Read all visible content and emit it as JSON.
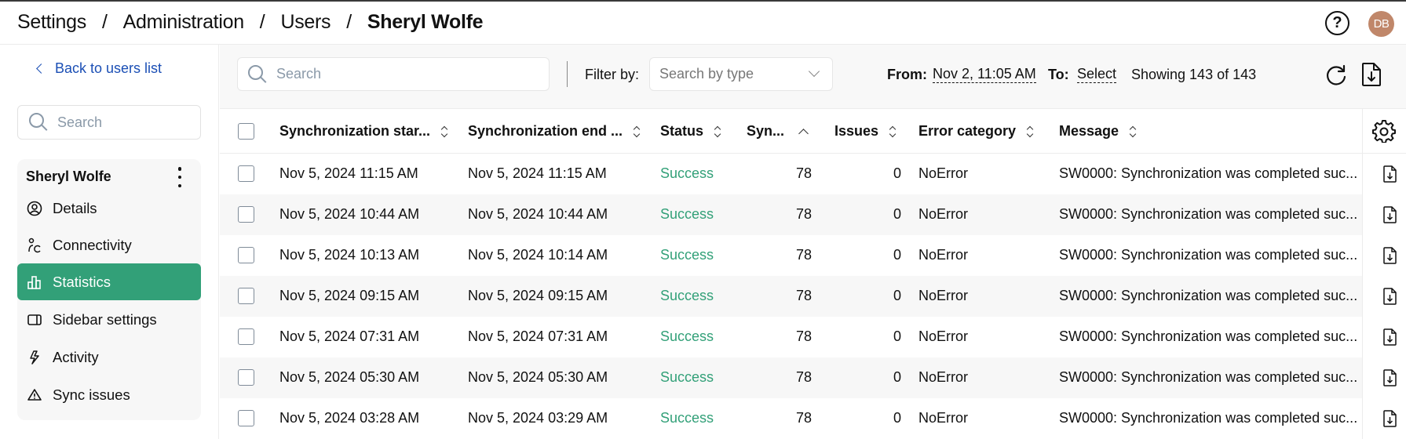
{
  "header": {
    "breadcrumb": [
      "Settings",
      "Administration",
      "Users",
      "Sheryl Wolfe"
    ],
    "separator": "/",
    "help_icon": "?",
    "avatar_initials": "DB"
  },
  "sidebar": {
    "back_label": "Back to users list",
    "search_placeholder": "Search",
    "user_name": "Sheryl Wolfe",
    "items": [
      {
        "label": "Details",
        "icon": "user-circle-icon"
      },
      {
        "label": "Connectivity",
        "icon": "connectivity-icon"
      },
      {
        "label": "Statistics",
        "icon": "bar-chart-icon",
        "active": true
      },
      {
        "label": "Sidebar settings",
        "icon": "sidebar-panel-icon"
      },
      {
        "label": "Activity",
        "icon": "lightning-icon"
      },
      {
        "label": "Sync issues",
        "icon": "warning-triangle-icon"
      }
    ]
  },
  "toolbar": {
    "search_placeholder": "Search",
    "filter_label": "Filter by:",
    "filter_placeholder": "Search by type",
    "from_label": "From:",
    "from_value": "Nov 2, 11:05 AM",
    "to_label": "To:",
    "to_value": "Select",
    "showing": "Showing 143 of 143"
  },
  "table": {
    "columns": [
      {
        "label": "Synchronization star...",
        "sort": "none"
      },
      {
        "label": "Synchronization end ...",
        "sort": "none"
      },
      {
        "label": "Status",
        "sort": "none"
      },
      {
        "label": "Syn...",
        "sort": "ascending"
      },
      {
        "label": "Issues",
        "sort": "none"
      },
      {
        "label": "Error category",
        "sort": "none"
      },
      {
        "label": "Message",
        "sort": "none"
      }
    ],
    "rows": [
      {
        "start": "Nov 5, 2024 11:15 AM",
        "end": "Nov 5, 2024 11:15 AM",
        "status": "Success",
        "synced": "78",
        "issues": "0",
        "error_category": "NoError",
        "message": "SW0000: Synchronization was completed suc..."
      },
      {
        "start": "Nov 5, 2024 10:44 AM",
        "end": "Nov 5, 2024 10:44 AM",
        "status": "Success",
        "synced": "78",
        "issues": "0",
        "error_category": "NoError",
        "message": "SW0000: Synchronization was completed suc..."
      },
      {
        "start": "Nov 5, 2024 10:13 AM",
        "end": "Nov 5, 2024 10:14 AM",
        "status": "Success",
        "synced": "78",
        "issues": "0",
        "error_category": "NoError",
        "message": "SW0000: Synchronization was completed suc..."
      },
      {
        "start": "Nov 5, 2024 09:15 AM",
        "end": "Nov 5, 2024 09:15 AM",
        "status": "Success",
        "synced": "78",
        "issues": "0",
        "error_category": "NoError",
        "message": "SW0000: Synchronization was completed suc..."
      },
      {
        "start": "Nov 5, 2024 07:31 AM",
        "end": "Nov 5, 2024 07:31 AM",
        "status": "Success",
        "synced": "78",
        "issues": "0",
        "error_category": "NoError",
        "message": "SW0000: Synchronization was completed suc..."
      },
      {
        "start": "Nov 5, 2024 05:30 AM",
        "end": "Nov 5, 2024 05:30 AM",
        "status": "Success",
        "synced": "78",
        "issues": "0",
        "error_category": "NoError",
        "message": "SW0000: Synchronization was completed suc..."
      },
      {
        "start": "Nov 5, 2024 03:28 AM",
        "end": "Nov 5, 2024 03:29 AM",
        "status": "Success",
        "synced": "78",
        "issues": "0",
        "error_category": "NoError",
        "message": "SW0000: Synchronization was completed suc..."
      }
    ]
  },
  "colors": {
    "accent": "#32a078",
    "link": "#1b4fb5",
    "avatar": "#c0876a",
    "success": "#32a078"
  }
}
